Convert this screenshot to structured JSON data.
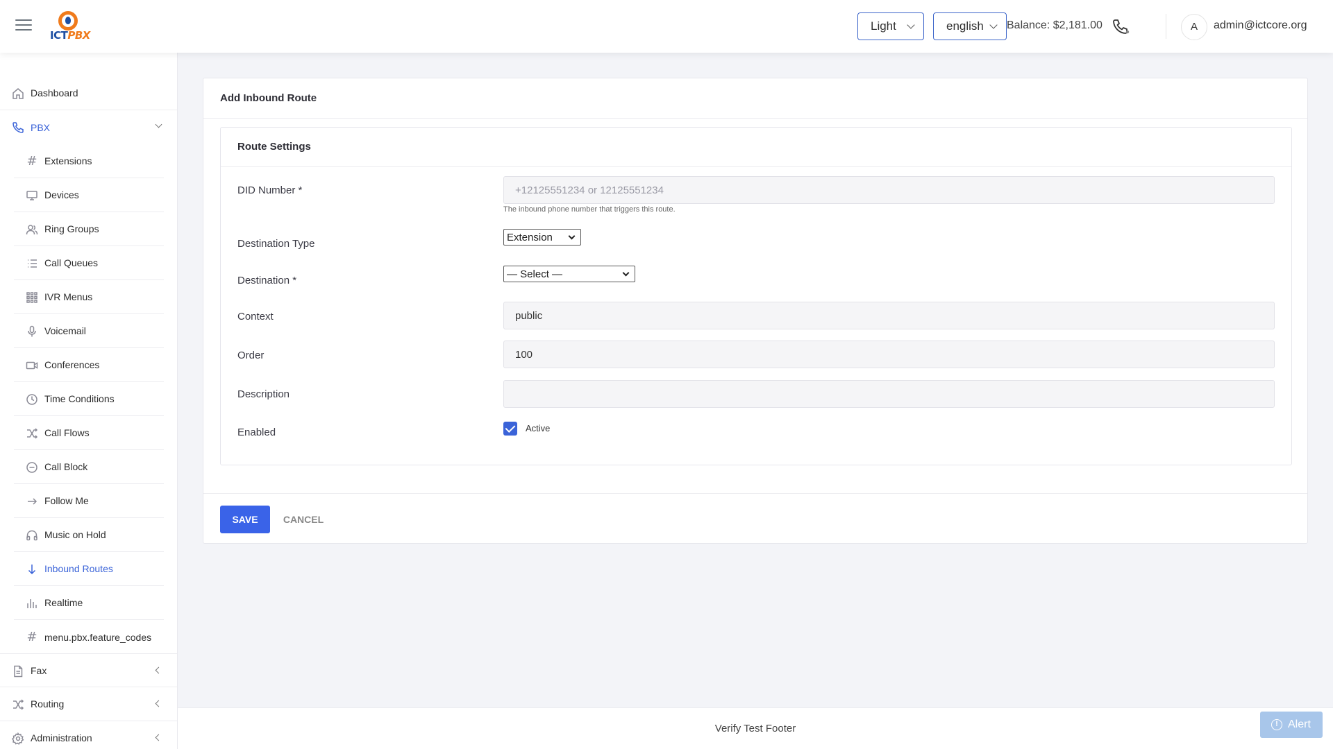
{
  "header": {
    "theme_value": "Light",
    "language_value": "english",
    "balance": "Balance: $2,181.00",
    "avatar_initial": "A",
    "user_email": "admin@ictcore.org",
    "logo_text_a": "ICT",
    "logo_text_b": "PBX"
  },
  "sidebar": {
    "dashboard": "Dashboard",
    "pbx": "PBX",
    "pbx_items": [
      {
        "label": "Extensions",
        "icon": "hash-icon"
      },
      {
        "label": "Devices",
        "icon": "monitor-icon"
      },
      {
        "label": "Ring Groups",
        "icon": "users-icon"
      },
      {
        "label": "Call Queues",
        "icon": "list-icon"
      },
      {
        "label": "IVR Menus",
        "icon": "grid-icon"
      },
      {
        "label": "Voicemail",
        "icon": "microphone-icon"
      },
      {
        "label": "Conferences",
        "icon": "video-icon"
      },
      {
        "label": "Time Conditions",
        "icon": "clock-icon"
      },
      {
        "label": "Call Flows",
        "icon": "shuffle-icon"
      },
      {
        "label": "Call Block",
        "icon": "block-icon"
      },
      {
        "label": "Follow Me",
        "icon": "arrow-right-icon"
      },
      {
        "label": "Music on Hold",
        "icon": "headphones-icon"
      },
      {
        "label": "Inbound Routes",
        "icon": "arrow-down-icon"
      },
      {
        "label": "Realtime",
        "icon": "bars-icon"
      },
      {
        "label": "menu.pbx.feature_codes",
        "icon": "hash-icon"
      }
    ],
    "fax": "Fax",
    "routing": "Routing",
    "administration": "Administration",
    "active_color": "#3a63d8"
  },
  "page": {
    "title": "Add Inbound Route",
    "section_title": "Route Settings",
    "fields": {
      "did_label": "DID Number *",
      "did_placeholder": "+12125551234 or 12125551234",
      "did_value": "",
      "did_help": "The inbound phone number that triggers this route.",
      "dest_type_label": "Destination Type",
      "dest_type_value": "Extension",
      "destination_label": "Destination *",
      "destination_value": "— Select —",
      "context_label": "Context",
      "context_value": "public",
      "order_label": "Order",
      "order_value": "100",
      "description_label": "Description",
      "description_value": "",
      "enabled_label": "Enabled",
      "enabled_option": "Active",
      "enabled_checked": true
    },
    "save_label": "SAVE",
    "cancel_label": "CANCEL"
  },
  "footer": {
    "text": "Verify Test Footer",
    "alert_label": "Alert"
  },
  "colors": {
    "primary": "#3a63e8",
    "alert_bg": "#a8c6ea"
  }
}
